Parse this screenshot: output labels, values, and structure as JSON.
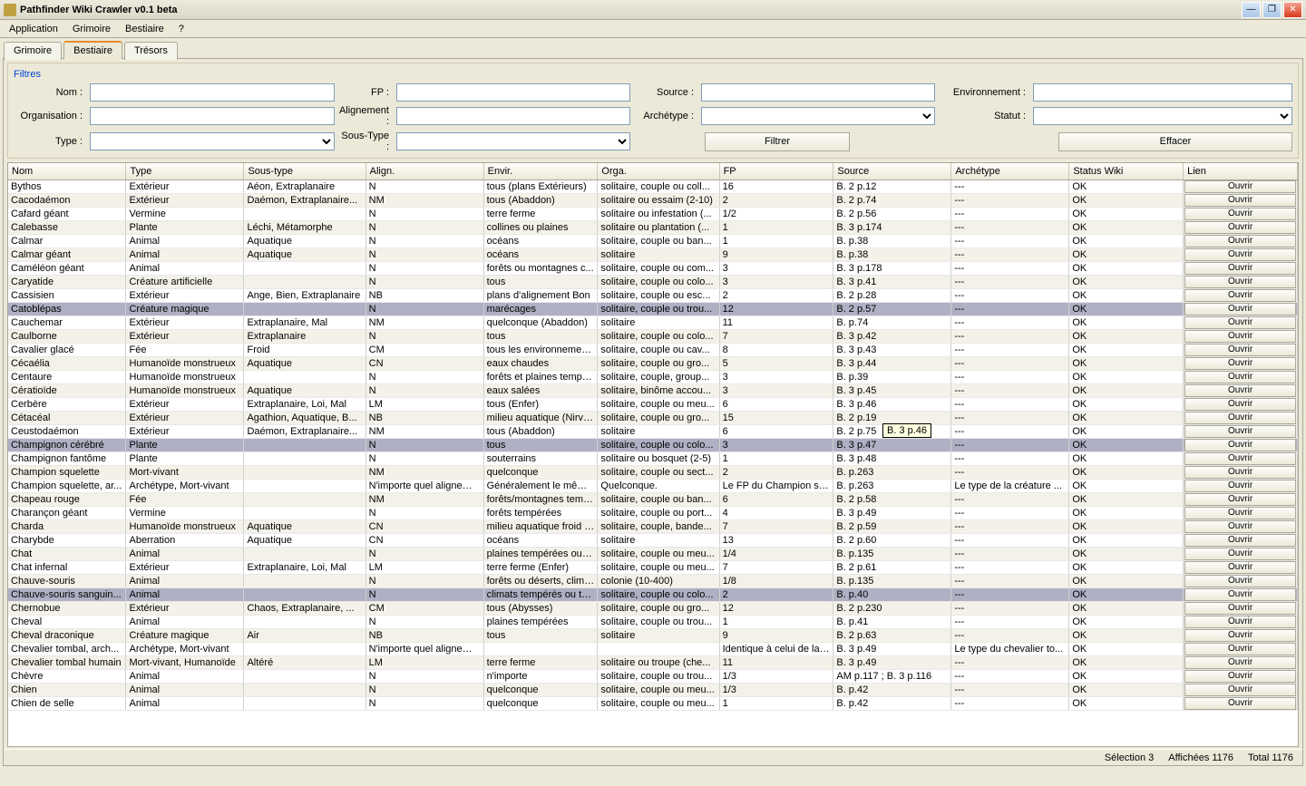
{
  "window": {
    "title": "Pathfinder Wiki Crawler v0.1 beta"
  },
  "menu": {
    "application": "Application",
    "grimoire": "Grimoire",
    "bestiaire": "Bestiaire",
    "help": "?"
  },
  "tabs": {
    "grimoire": "Grimoire",
    "bestiaire": "Bestiaire",
    "tresors": "Trésors"
  },
  "filters": {
    "title": "Filtres",
    "nom_label": "Nom :",
    "fp_label": "FP :",
    "source_label": "Source :",
    "env_label": "Environnement :",
    "org_label": "Organisation :",
    "align_label": "Alignement :",
    "arch_label": "Archétype :",
    "statut_label": "Statut :",
    "type_label": "Type :",
    "soustype_label": "Sous-Type :",
    "btn_filtrer": "Filtrer",
    "btn_effacer": "Effacer"
  },
  "columns": [
    "Nom",
    "Type",
    "Sous-type",
    "Align.",
    "Envir.",
    "Orga.",
    "FP",
    "Source",
    "Archétype",
    "Status Wiki",
    "Lien"
  ],
  "row_button": "Ouvrir",
  "tooltip": "B. 3 p.46",
  "status": {
    "selection": "Sélection 3",
    "affichees": "Affichées 1176",
    "total": "Total 1176"
  },
  "rows": [
    {
      "sel": false,
      "c": [
        "Bythos",
        "Extérieur",
        "Aéon, Extraplanaire",
        "N",
        "tous (plans Extérieurs)",
        "solitaire, couple ou coll...",
        "16",
        "B. 2 p.12",
        "---",
        "OK"
      ]
    },
    {
      "sel": false,
      "c": [
        "Cacodaémon",
        "Extérieur",
        "Daémon, Extraplanaire...",
        "NM",
        "tous (Abaddon)",
        "solitaire ou essaim (2-10)",
        "2",
        "B. 2 p.74",
        "---",
        "OK"
      ]
    },
    {
      "sel": false,
      "c": [
        "Cafard géant",
        "Vermine",
        "",
        "N",
        "terre ferme",
        "solitaire ou infestation (...",
        "1/2",
        "B. 2 p.56",
        "---",
        "OK"
      ]
    },
    {
      "sel": false,
      "c": [
        "Calebasse",
        "Plante",
        "Léchi, Métamorphe",
        "N",
        "collines ou plaines",
        "solitaire ou plantation (...",
        "1",
        "B. 3 p.174",
        "---",
        "OK"
      ]
    },
    {
      "sel": false,
      "c": [
        "Calmar",
        "Animal",
        "Aquatique",
        "N",
        "océans",
        "solitaire, couple ou ban...",
        "1",
        "B. p.38",
        "---",
        "OK"
      ]
    },
    {
      "sel": false,
      "c": [
        "Calmar géant",
        "Animal",
        "Aquatique",
        "N",
        "océans",
        "solitaire",
        "9",
        "B. p.38",
        "---",
        "OK"
      ]
    },
    {
      "sel": false,
      "c": [
        "Caméléon géant",
        "Animal",
        "",
        "N",
        "forêts ou montagnes c...",
        "solitaire, couple ou com...",
        "3",
        "B. 3 p.178",
        "---",
        "OK"
      ]
    },
    {
      "sel": false,
      "c": [
        "Caryatide",
        "Créature artificielle",
        "",
        "N",
        "tous",
        "solitaire, couple ou colo...",
        "3",
        "B. 3 p.41",
        "---",
        "OK"
      ]
    },
    {
      "sel": false,
      "c": [
        "Cassisien",
        "Extérieur",
        "Ange, Bien, Extraplanaire",
        "NB",
        "plans d'alignement Bon",
        "solitaire, couple ou esc...",
        "2",
        "B. 2 p.28",
        "---",
        "OK"
      ]
    },
    {
      "sel": true,
      "c": [
        "Catoblépas",
        "Créature magique",
        "",
        "N",
        "marécages",
        "solitaire, couple ou trou...",
        "12",
        "B. 2 p.57",
        "---",
        "OK"
      ]
    },
    {
      "sel": false,
      "c": [
        "Cauchemar",
        "Extérieur",
        "Extraplanaire, Mal",
        "NM",
        "quelconque (Abaddon)",
        "solitaire",
        "11",
        "B. p.74",
        "---",
        "OK"
      ]
    },
    {
      "sel": false,
      "c": [
        "Caulborne",
        "Extérieur",
        "Extraplanaire",
        "N",
        "tous",
        "solitaire, couple ou colo...",
        "7",
        "B. 3 p.42",
        "---",
        "OK"
      ]
    },
    {
      "sel": false,
      "c": [
        "Cavalier glacé",
        "Fée",
        "Froid",
        "CM",
        "tous les environnemen...",
        "solitaire, couple ou cav...",
        "8",
        "B. 3 p.43",
        "---",
        "OK"
      ]
    },
    {
      "sel": false,
      "c": [
        "Cécaélia",
        "Humanoïde monstrueux",
        "Aquatique",
        "CN",
        "eaux chaudes",
        "solitaire, couple ou gro...",
        "5",
        "B. 3 p.44",
        "---",
        "OK"
      ]
    },
    {
      "sel": false,
      "c": [
        "Centaure",
        "Humanoïde monstrueux",
        "",
        "N",
        "forêts et plaines tempé...",
        "solitaire, couple, group...",
        "3",
        "B. p.39",
        "---",
        "OK"
      ]
    },
    {
      "sel": false,
      "c": [
        "Cératioïde",
        "Humanoïde monstrueux",
        "Aquatique",
        "N",
        "eaux salées",
        "solitaire, binôme accou...",
        "3",
        "B. 3 p.45",
        "---",
        "OK"
      ]
    },
    {
      "sel": false,
      "c": [
        "Cerbère",
        "Extérieur",
        "Extraplanaire, Loi, Mal",
        "LM",
        "tous (Enfer)",
        "solitaire, couple ou meu...",
        "6",
        "B. 3 p.46",
        "---",
        "OK"
      ]
    },
    {
      "sel": false,
      "c": [
        "Cétacéal",
        "Extérieur",
        "Agathion, Aquatique, B...",
        "NB",
        "milieu aquatique (Nirvana)",
        "solitaire, couple ou gro...",
        "15",
        "B. 2 p.19",
        "---",
        "OK"
      ]
    },
    {
      "sel": false,
      "c": [
        "Ceustodaémon",
        "Extérieur",
        "Daémon, Extraplanaire...",
        "NM",
        "tous (Abaddon)",
        "solitaire",
        "6",
        "B. 2 p.75",
        "---",
        "OK"
      ]
    },
    {
      "sel": true,
      "c": [
        "Champignon cérébré",
        "Plante",
        "",
        "N",
        "tous",
        "solitaire, couple ou colo...",
        "3",
        "B. 3 p.47",
        "---",
        "OK"
      ]
    },
    {
      "sel": false,
      "c": [
        "Champignon fantôme",
        "Plante",
        "",
        "N",
        "souterrains",
        "solitaire ou bosquet (2-5)",
        "1",
        "B. 3 p.48",
        "---",
        "OK"
      ]
    },
    {
      "sel": false,
      "c": [
        "Champion squelette",
        "Mort-vivant",
        "",
        "NM",
        "quelconque",
        "solitaire, couple ou sect...",
        "2",
        "B. p.263",
        "---",
        "OK"
      ]
    },
    {
      "sel": false,
      "c": [
        "Champion squelette, ar...",
        "Archétype, Mort-vivant",
        "",
        "N'importe quel aligneme...",
        "Généralement le même ...",
        "Quelconque.",
        "Le FP du Champion squ...",
        "B. p.263",
        "Le type de la créature ...",
        "OK"
      ]
    },
    {
      "sel": false,
      "c": [
        "Chapeau rouge",
        "Fée",
        "",
        "NM",
        "forêts/montagnes temp...",
        "solitaire, couple ou ban...",
        "6",
        "B. 2 p.58",
        "---",
        "OK"
      ]
    },
    {
      "sel": false,
      "c": [
        "Charançon géant",
        "Vermine",
        "",
        "N",
        "forêts tempérées",
        "solitaire, couple ou port...",
        "4",
        "B. 3 p.49",
        "---",
        "OK"
      ]
    },
    {
      "sel": false,
      "c": [
        "Charda",
        "Humanoïde monstrueux",
        "Aquatique",
        "CN",
        "milieu aquatique froid o...",
        "solitaire, couple, bande...",
        "7",
        "B. 2 p.59",
        "---",
        "OK"
      ]
    },
    {
      "sel": false,
      "c": [
        "Charybde",
        "Aberration",
        "Aquatique",
        "CN",
        "océans",
        "solitaire",
        "13",
        "B. 2 p.60",
        "---",
        "OK"
      ]
    },
    {
      "sel": false,
      "c": [
        "Chat",
        "Animal",
        "",
        "N",
        "plaines tempérées ou c...",
        "solitaire, couple ou meu...",
        "1/4",
        "B. p.135",
        "---",
        "OK"
      ]
    },
    {
      "sel": false,
      "c": [
        "Chat infernal",
        "Extérieur",
        "Extraplanaire, Loi, Mal",
        "LM",
        "terre ferme (Enfer)",
        "solitaire, couple ou meu...",
        "7",
        "B. 2 p.61",
        "---",
        "OK"
      ]
    },
    {
      "sel": false,
      "c": [
        "Chauve-souris",
        "Animal",
        "",
        "N",
        "forêts ou déserts, clima...",
        "colonie (10-400)",
        "1/8",
        "B. p.135",
        "---",
        "OK"
      ]
    },
    {
      "sel": true,
      "c": [
        "Chauve-souris sanguin...",
        "Animal",
        "",
        "N",
        "climats tempérés ou tro...",
        "solitaire, couple ou colo...",
        "2",
        "B. p.40",
        "---",
        "OK"
      ]
    },
    {
      "sel": false,
      "c": [
        "Chernobue",
        "Extérieur",
        "Chaos, Extraplanaire, ...",
        "CM",
        "tous (Abysses)",
        "solitaire, couple ou gro...",
        "12",
        "B. 2 p.230",
        "---",
        "OK"
      ]
    },
    {
      "sel": false,
      "c": [
        "Cheval",
        "Animal",
        "",
        "N",
        "plaines tempérées",
        "solitaire, couple ou trou...",
        "1",
        "B. p.41",
        "---",
        "OK"
      ]
    },
    {
      "sel": false,
      "c": [
        "Cheval draconique",
        "Créature magique",
        "Air",
        "NB",
        "tous",
        "solitaire",
        "9",
        "B. 2 p.63",
        "---",
        "OK"
      ]
    },
    {
      "sel": false,
      "c": [
        "Chevalier tombal, arch...",
        "Archétype, Mort-vivant",
        "",
        "N'importe quel aligneme...",
        "",
        "",
        "Identique à celui de la c...",
        "B. 3 p.49",
        "Le type du chevalier to...",
        "OK"
      ]
    },
    {
      "sel": false,
      "c": [
        "Chevalier tombal humain",
        "Mort-vivant, Humanoïde",
        "Altéré",
        "LM",
        "terre ferme",
        "solitaire ou troupe (che...",
        "11",
        "B. 3 p.49",
        "---",
        "OK"
      ]
    },
    {
      "sel": false,
      "c": [
        "Chèvre",
        "Animal",
        "",
        "N",
        "n'importe",
        "solitaire, couple ou trou...",
        "1/3",
        "AM p.117 ; B. 3 p.116",
        "---",
        "OK"
      ]
    },
    {
      "sel": false,
      "c": [
        "Chien",
        "Animal",
        "",
        "N",
        "quelconque",
        "solitaire, couple ou meu...",
        "1/3",
        "B. p.42",
        "---",
        "OK"
      ]
    },
    {
      "sel": false,
      "c": [
        "Chien de selle",
        "Animal",
        "",
        "N",
        "quelconque",
        "solitaire, couple ou meu...",
        "1",
        "B. p.42",
        "---",
        "OK"
      ]
    }
  ]
}
